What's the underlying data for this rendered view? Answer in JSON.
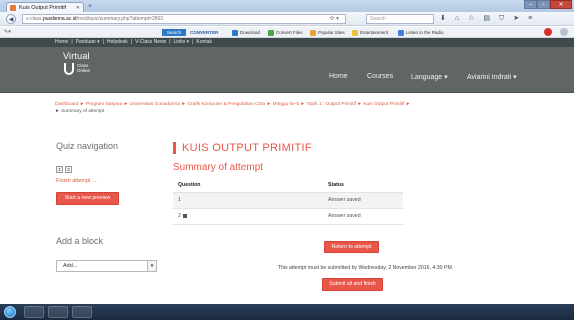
{
  "browser": {
    "tab_title": "Kuis Output Primitif",
    "new_tab": "+",
    "url_host": "pusdiema.ac.id",
    "url_rest": "/mod/quiz/summary.php?attempt=2803",
    "url_prefix": "v-class.",
    "search_placeholder": "Search",
    "bookmark_search": "Search",
    "bookmarks": [
      {
        "label": "Download",
        "color": "#2f78c8"
      },
      {
        "label": "Convert Files",
        "color": "#4da24a"
      },
      {
        "label": "Popular Sites",
        "color": "#e8a33a"
      },
      {
        "label": "Entertainment",
        "color": "#e8c53a"
      },
      {
        "label": "Listen to the Radio",
        "color": "#4a7de0"
      }
    ],
    "converter_brand": "CONVERTER"
  },
  "site": {
    "menu_items": [
      "Home",
      "|",
      "Panduan ▾",
      "|",
      "Helpdesk",
      "|",
      "V-Class News",
      "|",
      "Links ▾",
      "|",
      "Kontak"
    ],
    "logo_virtual": "Virtual",
    "logo_class": "Class",
    "logo_online": "Online",
    "nav": {
      "home": "Home",
      "courses": "Courses",
      "language": "Language ▾",
      "user": "Aviarini Indrati ▾"
    }
  },
  "breadcrumb": {
    "trail": "Dashboard ► Program Sarjana ► Universitas Gunadarma ► Grafik Komputer & Pengolahan Citra ► Minggu ke-5 ► Topik 1 : Output Primitif ► Kuis Output Primitif ►",
    "last": "Summary of attempt"
  },
  "quiz_nav": {
    "title": "Quiz navigation",
    "buttons": [
      "1",
      "2"
    ],
    "finish_label": "Finish attempt ...",
    "start_preview_label": "Start a new preview"
  },
  "add_block": {
    "title": "Add a block",
    "select_value": "Add...",
    "arrow": "▾"
  },
  "main": {
    "page_title": "KUIS OUTPUT PRIMITIF",
    "subtitle": "Summary of attempt",
    "table_headers": {
      "question": "Question",
      "status": "Status"
    },
    "rows": [
      {
        "question": "1",
        "status": "Answer saved"
      },
      {
        "question": "2",
        "status": "Answer saved"
      }
    ],
    "return_label": "Return to attempt",
    "submit_text": "This attempt must be submitted by Wednesday, 2 November 2016, 4:30 PM.",
    "submit_label": "Submit all and finish"
  },
  "colors": {
    "accent": "#e8574a",
    "header_bg": "#5f6665",
    "menubar_bg": "#3f4a4a"
  }
}
